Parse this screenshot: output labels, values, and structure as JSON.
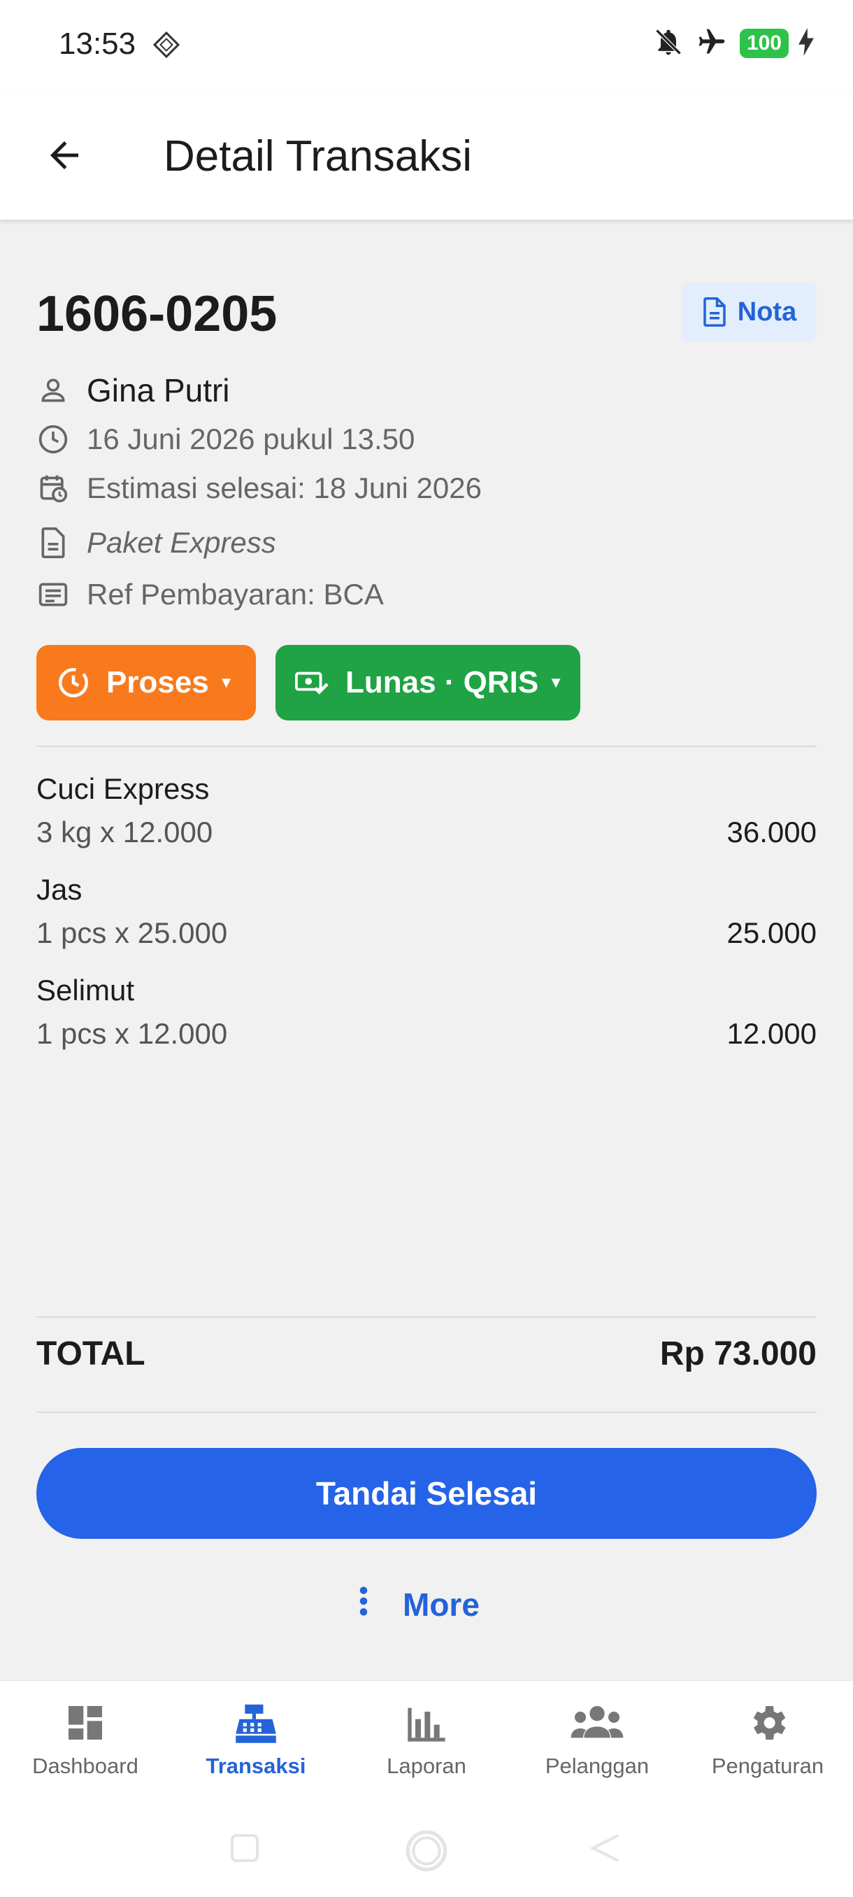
{
  "status_bar": {
    "time": "13:53",
    "battery": "100",
    "icons": [
      "diamond-icon",
      "bell-off-icon",
      "airplane-icon",
      "battery-icon",
      "charging-icon"
    ]
  },
  "app_bar": {
    "title": "Detail Transaksi",
    "back_icon": "arrow-left-icon"
  },
  "transaction": {
    "id": "1606-0205",
    "nota_label": "Nota",
    "customer": "Gina Putri",
    "datetime": "16 Juni 2026 pukul 13.50",
    "estimate": "Estimasi selesai: 18 Juni 2026",
    "package": "Paket Express",
    "payment_ref": "Ref Pembayaran: BCA",
    "status_label": "Proses",
    "payment_label": "Lunas · QRIS",
    "items": [
      {
        "name": "Cuci Express",
        "qty": "3 kg x 12.000",
        "subtotal": "36.000"
      },
      {
        "name": "Jas",
        "qty": "1 pcs x 25.000",
        "subtotal": "25.000"
      },
      {
        "name": "Selimut",
        "qty": "1 pcs x 12.000",
        "subtotal": "12.000"
      }
    ],
    "total_label": "TOTAL",
    "total_value": "Rp 73.000"
  },
  "actions": {
    "primary": "Tandai Selesai",
    "more": "More"
  },
  "bottom_nav": {
    "items": [
      {
        "label": "Dashboard",
        "icon": "dashboard-icon"
      },
      {
        "label": "Transaksi",
        "icon": "cash-register-icon"
      },
      {
        "label": "Laporan",
        "icon": "bar-chart-icon"
      },
      {
        "label": "Pelanggan",
        "icon": "people-icon"
      },
      {
        "label": "Pengaturan",
        "icon": "gear-icon"
      }
    ],
    "active": "Transaksi"
  },
  "colors": {
    "accent": "#2563e8",
    "status_orange": "#f87a1c",
    "paid_green": "#1fa344",
    "nota_bg": "#e2eefb"
  }
}
